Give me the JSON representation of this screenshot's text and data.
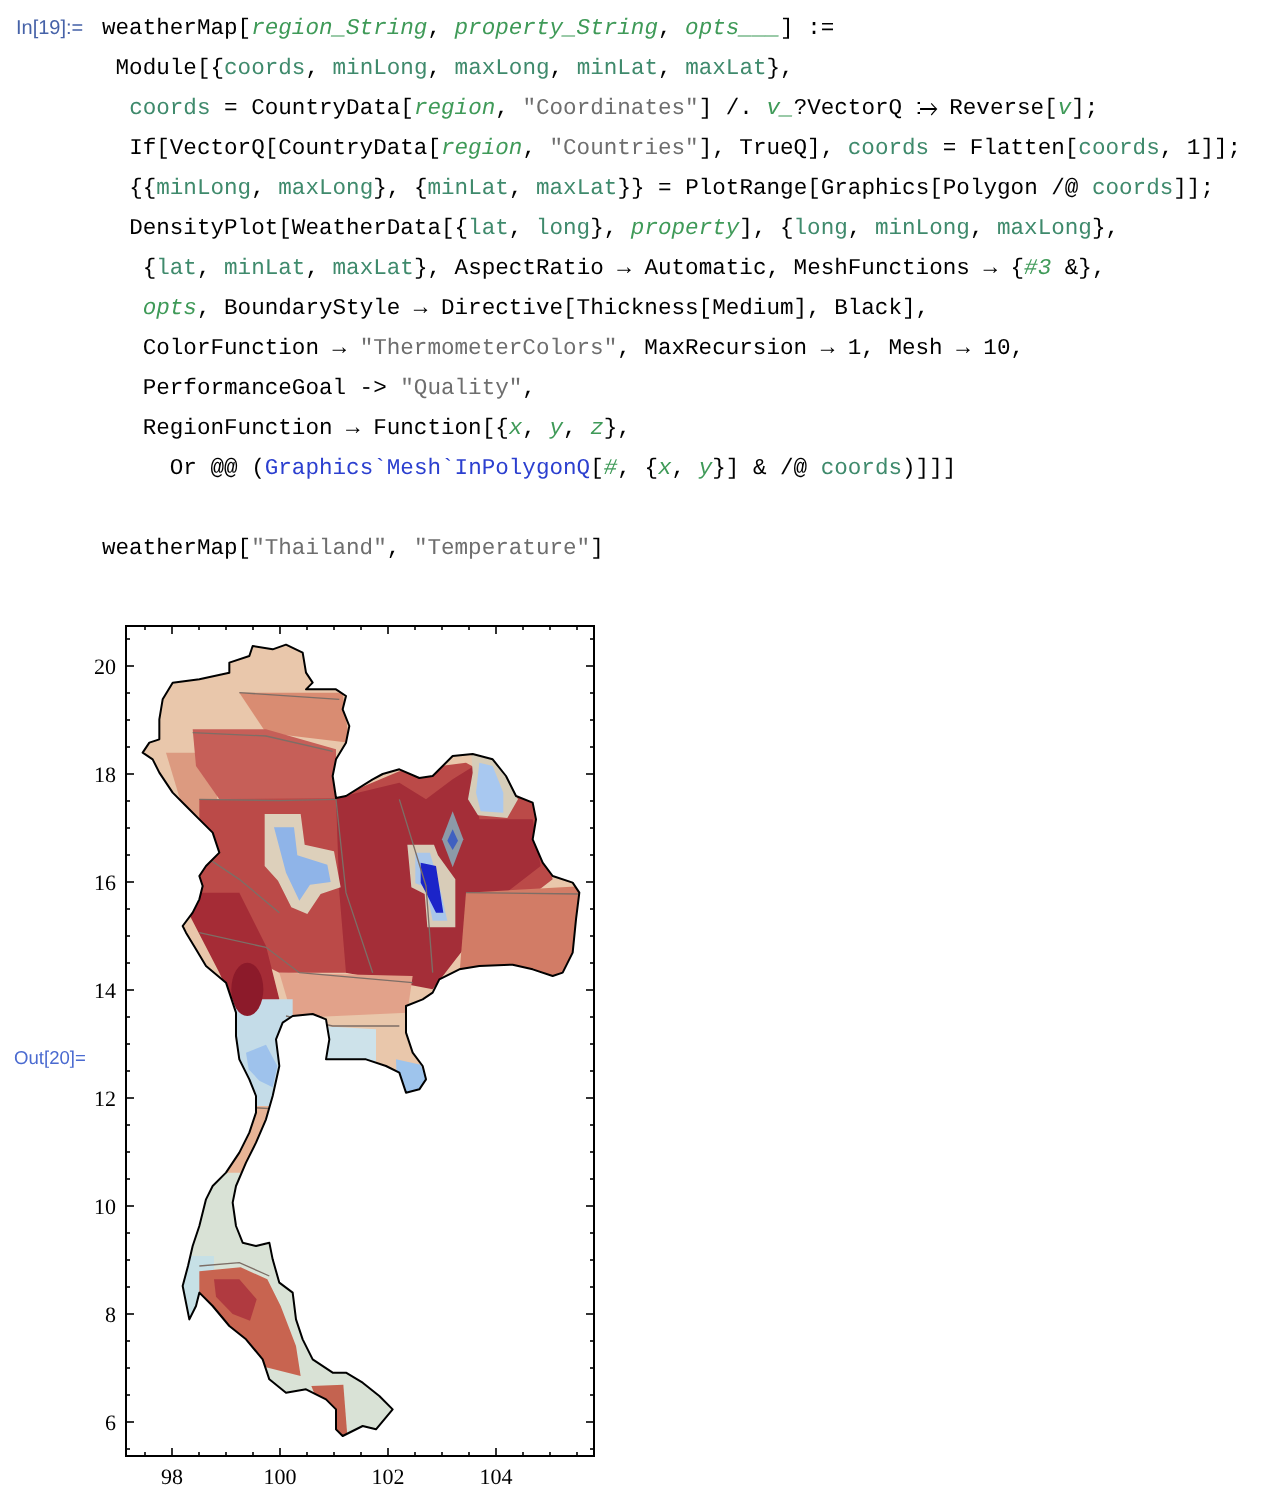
{
  "notebook": {
    "cells": [
      {
        "kind": "input",
        "label": "In[19]:=",
        "lines": [
          {
            "tokens": [
              {
                "text": "weatherMap[",
                "kind": "symbol"
              },
              {
                "text": "region_String",
                "kind": "argument"
              },
              {
                "text": ", ",
                "kind": "symbol"
              },
              {
                "text": "property_String",
                "kind": "argument"
              },
              {
                "text": ", ",
                "kind": "symbol"
              },
              {
                "text": "opts___",
                "kind": "argument"
              },
              {
                "text": "] :=",
                "kind": "symbol"
              }
            ]
          },
          {
            "tokens": [
              {
                "text": " Module[{",
                "kind": "symbol"
              },
              {
                "text": "coords",
                "kind": "local"
              },
              {
                "text": ", ",
                "kind": "symbol"
              },
              {
                "text": "minLong",
                "kind": "local"
              },
              {
                "text": ", ",
                "kind": "symbol"
              },
              {
                "text": "maxLong",
                "kind": "local"
              },
              {
                "text": ", ",
                "kind": "symbol"
              },
              {
                "text": "minLat",
                "kind": "local"
              },
              {
                "text": ", ",
                "kind": "symbol"
              },
              {
                "text": "maxLat",
                "kind": "local"
              },
              {
                "text": "},",
                "kind": "symbol"
              }
            ]
          },
          {
            "tokens": [
              {
                "text": "  coords",
                "kind": "local"
              },
              {
                "text": " = CountryData[",
                "kind": "symbol"
              },
              {
                "text": "region",
                "kind": "argument"
              },
              {
                "text": ", ",
                "kind": "symbol"
              },
              {
                "text": "\"Coordinates\"",
                "kind": "string"
              },
              {
                "text": "] /. ",
                "kind": "symbol"
              },
              {
                "text": "v_",
                "kind": "argument"
              },
              {
                "text": "?VectorQ ⧴ Reverse[",
                "kind": "symbol"
              },
              {
                "text": "v",
                "kind": "argument"
              },
              {
                "text": "];",
                "kind": "symbol"
              }
            ]
          },
          {
            "tokens": [
              {
                "text": "  If[VectorQ[CountryData[",
                "kind": "symbol"
              },
              {
                "text": "region",
                "kind": "argument"
              },
              {
                "text": ", ",
                "kind": "symbol"
              },
              {
                "text": "\"Countries\"",
                "kind": "string"
              },
              {
                "text": "], TrueQ], ",
                "kind": "symbol"
              },
              {
                "text": "coords",
                "kind": "local"
              },
              {
                "text": " = Flatten[",
                "kind": "symbol"
              },
              {
                "text": "coords",
                "kind": "local"
              },
              {
                "text": ", 1]];",
                "kind": "symbol"
              }
            ]
          },
          {
            "tokens": [
              {
                "text": "  {{",
                "kind": "symbol"
              },
              {
                "text": "minLong",
                "kind": "local"
              },
              {
                "text": ", ",
                "kind": "symbol"
              },
              {
                "text": "maxLong",
                "kind": "local"
              },
              {
                "text": "}, {",
                "kind": "symbol"
              },
              {
                "text": "minLat",
                "kind": "local"
              },
              {
                "text": ", ",
                "kind": "symbol"
              },
              {
                "text": "maxLat",
                "kind": "local"
              },
              {
                "text": "}} = PlotRange[Graphics[Polygon /@ ",
                "kind": "symbol"
              },
              {
                "text": "coords",
                "kind": "local"
              },
              {
                "text": "]];",
                "kind": "symbol"
              }
            ]
          },
          {
            "tokens": [
              {
                "text": "  DensityPlot[WeatherData[{",
                "kind": "symbol"
              },
              {
                "text": "lat",
                "kind": "local"
              },
              {
                "text": ", ",
                "kind": "symbol"
              },
              {
                "text": "long",
                "kind": "local"
              },
              {
                "text": "}, ",
                "kind": "symbol"
              },
              {
                "text": "property",
                "kind": "argument"
              },
              {
                "text": "], {",
                "kind": "symbol"
              },
              {
                "text": "long",
                "kind": "local"
              },
              {
                "text": ", ",
                "kind": "symbol"
              },
              {
                "text": "minLong",
                "kind": "local"
              },
              {
                "text": ", ",
                "kind": "symbol"
              },
              {
                "text": "maxLong",
                "kind": "local"
              },
              {
                "text": "},",
                "kind": "symbol"
              }
            ]
          },
          {
            "tokens": [
              {
                "text": "   {",
                "kind": "symbol"
              },
              {
                "text": "lat",
                "kind": "local"
              },
              {
                "text": ", ",
                "kind": "symbol"
              },
              {
                "text": "minLat",
                "kind": "local"
              },
              {
                "text": ", ",
                "kind": "symbol"
              },
              {
                "text": "maxLat",
                "kind": "local"
              },
              {
                "text": "}, AspectRatio → Automatic, MeshFunctions → {",
                "kind": "symbol"
              },
              {
                "text": "#3",
                "kind": "argument"
              },
              {
                "text": " &},",
                "kind": "symbol"
              }
            ]
          },
          {
            "tokens": [
              {
                "text": "   opts",
                "kind": "argument"
              },
              {
                "text": ", BoundaryStyle → Directive[Thickness[Medium], Black],",
                "kind": "symbol"
              }
            ]
          },
          {
            "tokens": [
              {
                "text": "   ColorFunction → ",
                "kind": "symbol"
              },
              {
                "text": "\"ThermometerColors\"",
                "kind": "string"
              },
              {
                "text": ", MaxRecursion → 1, Mesh → 10,",
                "kind": "symbol"
              }
            ]
          },
          {
            "tokens": [
              {
                "text": "   PerformanceGoal -> ",
                "kind": "symbol"
              },
              {
                "text": "\"Quality\"",
                "kind": "string"
              },
              {
                "text": ",",
                "kind": "symbol"
              }
            ]
          },
          {
            "tokens": [
              {
                "text": "   RegionFunction → Function[{",
                "kind": "symbol"
              },
              {
                "text": "x",
                "kind": "argument"
              },
              {
                "text": ", ",
                "kind": "symbol"
              },
              {
                "text": "y",
                "kind": "argument"
              },
              {
                "text": ", ",
                "kind": "symbol"
              },
              {
                "text": "z",
                "kind": "argument"
              },
              {
                "text": "},",
                "kind": "symbol"
              }
            ]
          },
          {
            "tokens": [
              {
                "text": "     Or @@ (",
                "kind": "symbol"
              },
              {
                "text": "Graphics`Mesh`InPolygonQ",
                "kind": "undefined"
              },
              {
                "text": "[",
                "kind": "symbol"
              },
              {
                "text": "#",
                "kind": "argument"
              },
              {
                "text": ", {",
                "kind": "symbol"
              },
              {
                "text": "x",
                "kind": "argument"
              },
              {
                "text": ", ",
                "kind": "symbol"
              },
              {
                "text": "y",
                "kind": "argument"
              },
              {
                "text": "}] & /@ ",
                "kind": "symbol"
              },
              {
                "text": "coords",
                "kind": "local"
              },
              {
                "text": ")]]]",
                "kind": "symbol"
              }
            ]
          }
        ]
      },
      {
        "kind": "input",
        "lines": [
          {
            "tokens": [
              {
                "text": "weatherMap[",
                "kind": "symbol"
              },
              {
                "text": "\"Thailand\"",
                "kind": "string"
              },
              {
                "text": ", ",
                "kind": "symbol"
              },
              {
                "text": "\"Temperature\"",
                "kind": "string"
              },
              {
                "text": "]",
                "kind": "symbol"
              }
            ]
          }
        ]
      },
      {
        "kind": "output",
        "label": "Out[20]=",
        "plot": {
          "x_tick_labels": [
            "98",
            "100",
            "102",
            "104"
          ],
          "y_tick_labels": [
            "20",
            "18",
            "16",
            "14",
            "12",
            "10",
            "8",
            "6"
          ]
        }
      }
    ]
  }
}
